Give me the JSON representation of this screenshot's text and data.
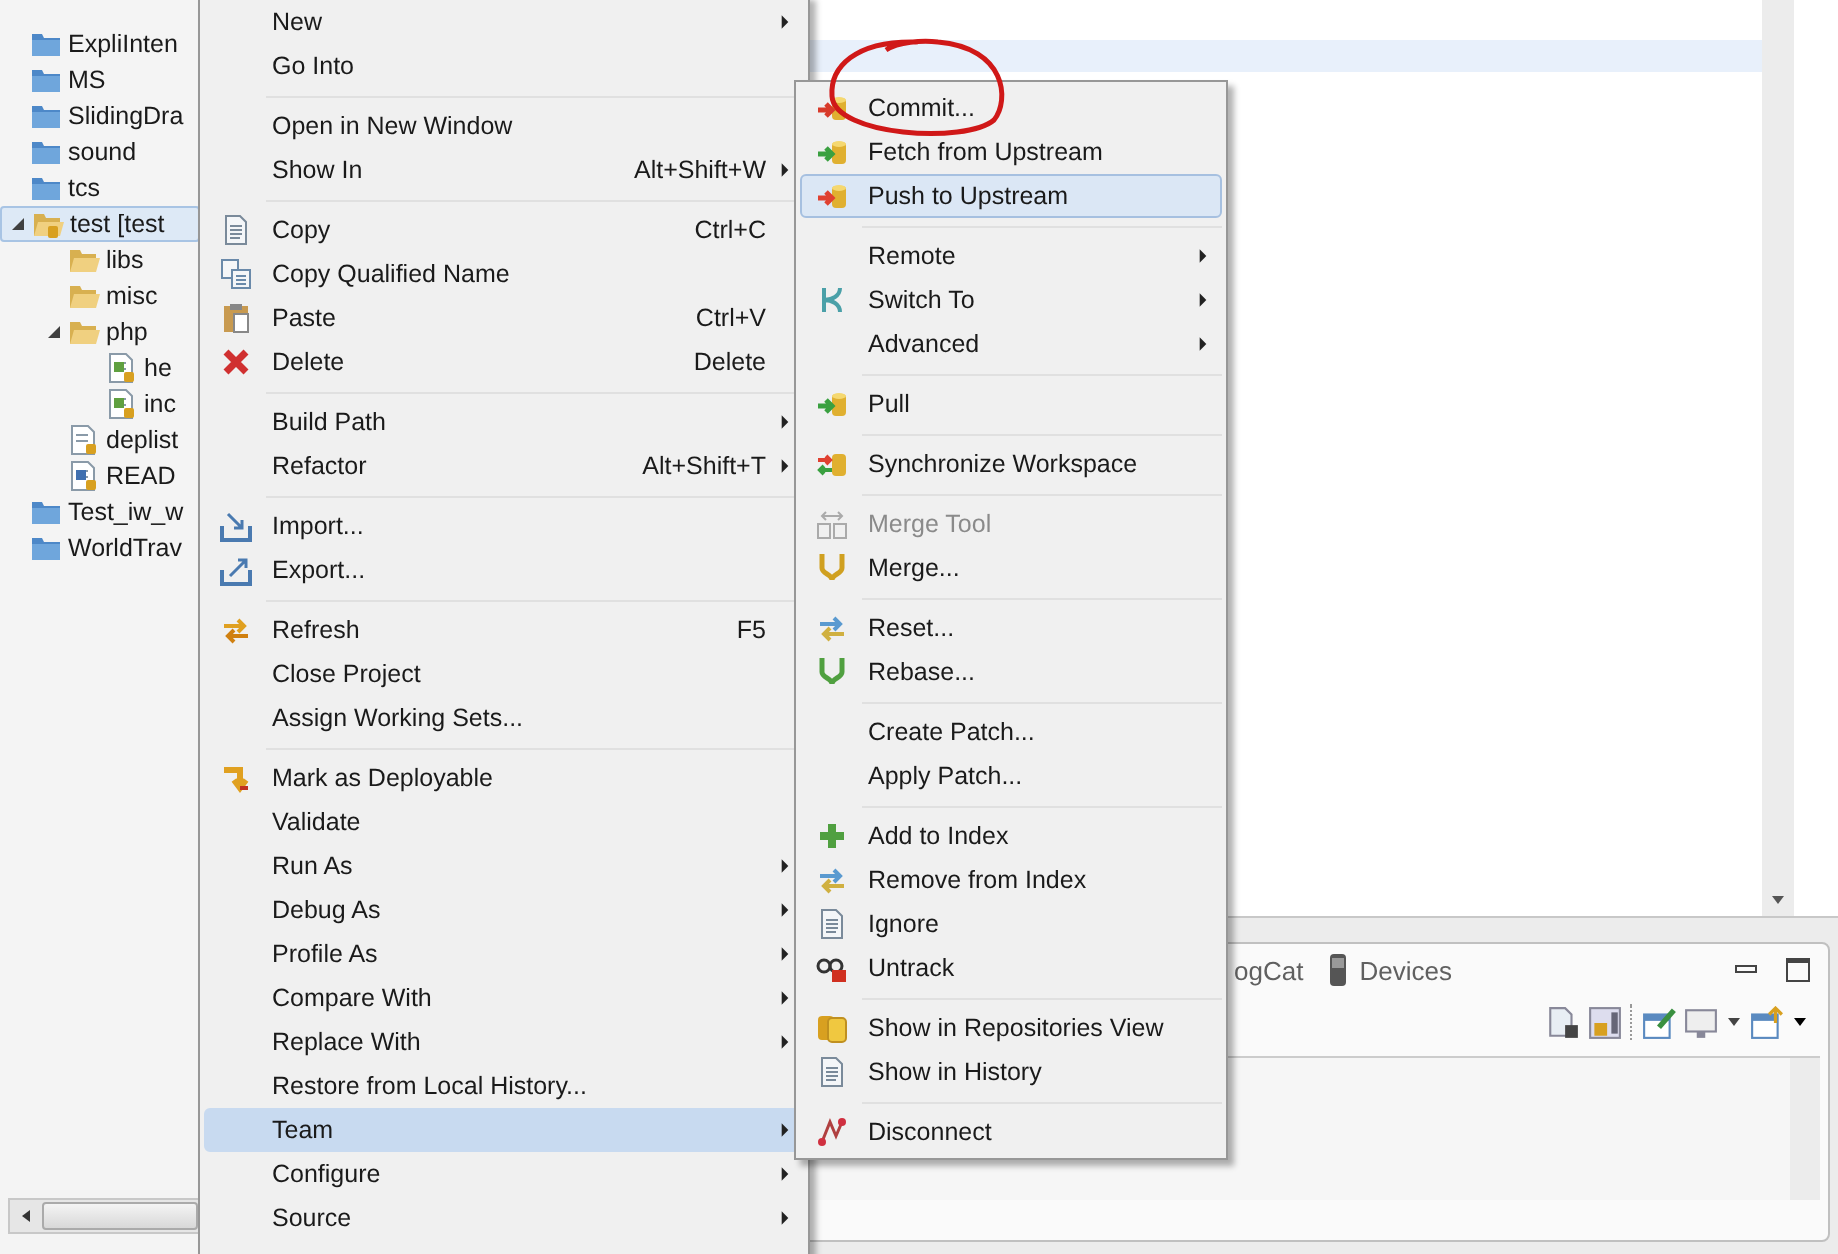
{
  "tree": {
    "items": [
      {
        "label": "ExpliInten",
        "kind": "project",
        "selected": false
      },
      {
        "label": "MS",
        "kind": "project",
        "selected": false
      },
      {
        "label": "SlidingDra",
        "kind": "project",
        "selected": false
      },
      {
        "label": "sound",
        "kind": "project",
        "selected": false
      },
      {
        "label": "tcs",
        "kind": "project",
        "selected": false
      },
      {
        "label": "test [test",
        "kind": "open-project",
        "selected": true,
        "expanded": true,
        "children": [
          {
            "label": "libs",
            "kind": "folder",
            "selected": false
          },
          {
            "label": "misc",
            "kind": "folder",
            "selected": false
          },
          {
            "label": "php",
            "kind": "folder",
            "selected": false,
            "expanded": true,
            "children": [
              {
                "label": "he",
                "kind": "php-file",
                "selected": false
              },
              {
                "label": "inc",
                "kind": "php-file",
                "selected": false
              }
            ]
          },
          {
            "label": "deplist",
            "kind": "file",
            "selected": false
          },
          {
            "label": "READ",
            "kind": "readme-file",
            "selected": false
          }
        ]
      },
      {
        "label": "Test_iw_w",
        "kind": "project",
        "selected": false
      },
      {
        "label": "WorldTrav",
        "kind": "project",
        "selected": false
      }
    ]
  },
  "bottom_panel": {
    "tabs": [
      {
        "label": "ogCat"
      },
      {
        "label": "Devices"
      }
    ]
  },
  "menus": [
    {
      "items": [
        {
          "kind": "item",
          "label": "New",
          "submenu": true,
          "selected": false
        },
        {
          "kind": "item",
          "label": "Go Into",
          "selected": false
        },
        {
          "kind": "separator"
        },
        {
          "kind": "item",
          "label": "Open in New Window",
          "selected": false
        },
        {
          "kind": "item",
          "label": "Show In",
          "shortcut": "Alt+Shift+W",
          "submenu": true,
          "selected": false
        },
        {
          "kind": "separator"
        },
        {
          "kind": "item",
          "label": "Copy",
          "shortcut": "Ctrl+C",
          "selected": false
        },
        {
          "kind": "item",
          "label": "Copy Qualified Name",
          "selected": false
        },
        {
          "kind": "item",
          "label": "Paste",
          "shortcut": "Ctrl+V",
          "selected": false
        },
        {
          "kind": "item",
          "label": "Delete",
          "shortcut": "Delete",
          "selected": false
        },
        {
          "kind": "separator"
        },
        {
          "kind": "item",
          "label": "Build Path",
          "submenu": true,
          "selected": false
        },
        {
          "kind": "item",
          "label": "Refactor",
          "shortcut": "Alt+Shift+T",
          "submenu": true,
          "selected": false
        },
        {
          "kind": "separator"
        },
        {
          "kind": "item",
          "label": "Import...",
          "selected": false
        },
        {
          "kind": "item",
          "label": "Export...",
          "selected": false
        },
        {
          "kind": "separator"
        },
        {
          "kind": "item",
          "label": "Refresh",
          "shortcut": "F5",
          "selected": false
        },
        {
          "kind": "item",
          "label": "Close Project",
          "selected": false
        },
        {
          "kind": "item",
          "label": "Assign Working Sets...",
          "selected": false
        },
        {
          "kind": "separator"
        },
        {
          "kind": "item",
          "label": "Mark as Deployable",
          "selected": false
        },
        {
          "kind": "item",
          "label": "Validate",
          "selected": false
        },
        {
          "kind": "item",
          "label": "Run As",
          "submenu": true,
          "selected": false
        },
        {
          "kind": "item",
          "label": "Debug As",
          "submenu": true,
          "selected": false
        },
        {
          "kind": "item",
          "label": "Profile As",
          "submenu": true,
          "selected": false
        },
        {
          "kind": "item",
          "label": "Compare With",
          "submenu": true,
          "selected": false
        },
        {
          "kind": "item",
          "label": "Replace With",
          "submenu": true,
          "selected": false
        },
        {
          "kind": "item",
          "label": "Restore from Local History...",
          "selected": false
        },
        {
          "kind": "item",
          "label": "Team",
          "submenu": true,
          "selected": true
        },
        {
          "kind": "item",
          "label": "Configure",
          "submenu": true,
          "selected": false
        },
        {
          "kind": "item",
          "label": "Source",
          "submenu": true,
          "selected": false
        }
      ]
    },
    {
      "items": [
        {
          "kind": "item",
          "label": "Commit...",
          "selected": false,
          "disabled": false
        },
        {
          "kind": "item",
          "label": "Fetch from Upstream",
          "selected": false,
          "disabled": false
        },
        {
          "kind": "item",
          "label": "Push to Upstream",
          "selected": true,
          "disabled": false
        },
        {
          "kind": "separator"
        },
        {
          "kind": "item",
          "label": "Remote",
          "submenu": true,
          "selected": false,
          "disabled": false
        },
        {
          "kind": "item",
          "label": "Switch To",
          "submenu": true,
          "selected": false,
          "disabled": false
        },
        {
          "kind": "item",
          "label": "Advanced",
          "submenu": true,
          "selected": false,
          "disabled": false
        },
        {
          "kind": "separator"
        },
        {
          "kind": "item",
          "label": "Pull",
          "selected": false,
          "disabled": false
        },
        {
          "kind": "separator"
        },
        {
          "kind": "item",
          "label": "Synchronize Workspace",
          "selected": false,
          "disabled": false
        },
        {
          "kind": "separator"
        },
        {
          "kind": "item",
          "label": "Merge Tool",
          "selected": false,
          "disabled": true
        },
        {
          "kind": "item",
          "label": "Merge...",
          "selected": false,
          "disabled": false
        },
        {
          "kind": "separator"
        },
        {
          "kind": "item",
          "label": "Reset...",
          "selected": false,
          "disabled": false
        },
        {
          "kind": "item",
          "label": "Rebase...",
          "selected": false,
          "disabled": false
        },
        {
          "kind": "separator"
        },
        {
          "kind": "item",
          "label": "Create Patch...",
          "selected": false,
          "disabled": false
        },
        {
          "kind": "item",
          "label": "Apply Patch...",
          "selected": false,
          "disabled": false
        },
        {
          "kind": "separator"
        },
        {
          "kind": "item",
          "label": "Add to Index",
          "selected": false,
          "disabled": false
        },
        {
          "kind": "item",
          "label": "Remove from Index",
          "selected": false,
          "disabled": false
        },
        {
          "kind": "item",
          "label": "Ignore",
          "selected": false,
          "disabled": false
        },
        {
          "kind": "item",
          "label": "Untrack",
          "selected": false,
          "disabled": false
        },
        {
          "kind": "separator"
        },
        {
          "kind": "item",
          "label": "Show in Repositories View",
          "selected": false,
          "disabled": false
        },
        {
          "kind": "item",
          "label": "Show in History",
          "selected": false,
          "disabled": false
        },
        {
          "kind": "separator"
        },
        {
          "kind": "item",
          "label": "Disconnect",
          "selected": false,
          "disabled": false
        }
      ]
    }
  ]
}
